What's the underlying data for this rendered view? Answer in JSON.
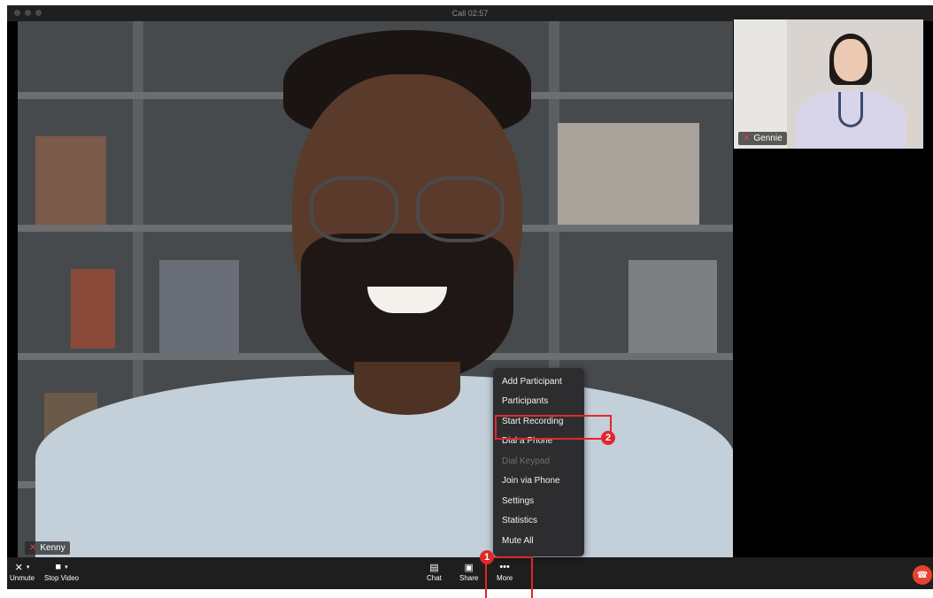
{
  "window": {
    "title": "Call 02:57"
  },
  "main_participant": {
    "name": "Kenny"
  },
  "thumbnail_participant": {
    "name": "Gennie"
  },
  "toolbar": {
    "unmute_label": "Unmute",
    "stop_video_label": "Stop Video",
    "chat_label": "Chat",
    "share_label": "Share",
    "more_label": "More"
  },
  "more_menu": {
    "items": [
      {
        "label": "Add Participant",
        "enabled": true
      },
      {
        "label": "Participants",
        "enabled": true
      },
      {
        "label": "Start Recording",
        "enabled": true
      },
      {
        "label": "Dial a Phone",
        "enabled": true
      },
      {
        "label": "Dial Keypad",
        "enabled": false
      },
      {
        "label": "Join via Phone",
        "enabled": true
      },
      {
        "label": "Settings",
        "enabled": true
      },
      {
        "label": "Statistics",
        "enabled": true
      },
      {
        "label": "Mute All",
        "enabled": true
      }
    ]
  },
  "annotations": {
    "step1": "1",
    "step2": "2"
  },
  "colors": {
    "end_call": "#e8422f",
    "annotation": "#e0272b",
    "muted": "#e5453a"
  },
  "icons": [
    "mic-off-icon",
    "video-camera-icon",
    "chevron-down-icon",
    "chat-icon",
    "share-screen-icon",
    "more-dots-icon",
    "end-call-icon"
  ]
}
